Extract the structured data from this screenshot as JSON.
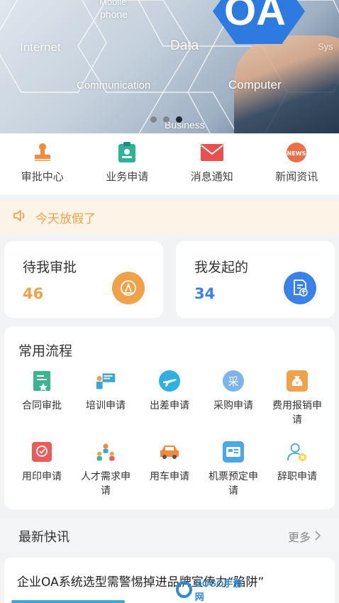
{
  "banner": {
    "labels": {
      "mobile": "Mobile",
      "phone": "phone",
      "internet": "Internet",
      "data": "Data",
      "communication": "Communication",
      "computer": "Computer",
      "business": "Business",
      "oa": "OA",
      "sys": "Sys"
    },
    "dots_count": 3,
    "active_dot": 3
  },
  "top_menu": [
    {
      "label": "审批中心",
      "icon": "stamp-icon",
      "color": "#f08a3c"
    },
    {
      "label": "业务申请",
      "icon": "business-clipboard-icon",
      "color": "#2eb39a"
    },
    {
      "label": "消息通知",
      "icon": "envelope-icon",
      "color": "#e8514d"
    },
    {
      "label": "新闻资讯",
      "icon": "news-badge-icon",
      "color": "#e8714a"
    }
  ],
  "notice": {
    "text": "今天放假了",
    "icon": "speaker-icon",
    "color": "#f0a24a"
  },
  "stats": {
    "pending": {
      "title": "待我审批",
      "value": "46",
      "color": "#f0a24a",
      "icon": "approve-icon"
    },
    "initiated": {
      "title": "我发起的",
      "value": "34",
      "color": "#3b82e8",
      "icon": "document-upload-icon"
    }
  },
  "flows": {
    "title": "常用流程",
    "items": [
      {
        "label": "合同审批",
        "icon": "contract-icon",
        "color": "#3cb391"
      },
      {
        "label": "培训申请",
        "icon": "training-board-icon",
        "color": "#3ea6d6"
      },
      {
        "label": "出差申请",
        "icon": "airplane-icon",
        "color": "#2fb0e0"
      },
      {
        "label": "采购申请",
        "icon": "purchase-icon",
        "color": "#7db4ea",
        "glyph": "采"
      },
      {
        "label": "费用报销申请",
        "icon": "money-bag-icon",
        "color": "#f0a24a"
      },
      {
        "label": "用印申请",
        "icon": "seal-icon",
        "color": "#ec5a5a"
      },
      {
        "label": "人才需求申请",
        "icon": "people-icon",
        "color": "#3ea6d6"
      },
      {
        "label": "用车申请",
        "icon": "car-icon",
        "color": "#f08a3c"
      },
      {
        "label": "机票预定申请",
        "icon": "ticket-icon",
        "color": "#4aa8e8"
      },
      {
        "label": "辞职申请",
        "icon": "resign-user-icon",
        "color": "#4aa8e8"
      }
    ]
  },
  "news": {
    "title": "最新快讯",
    "more": "更多",
    "items": [
      {
        "headline": "企业OA系统选型需警惕掉进品牌宣传力“陷阱”"
      }
    ]
  },
  "watermark": {
    "text": "GOGO手游网"
  }
}
